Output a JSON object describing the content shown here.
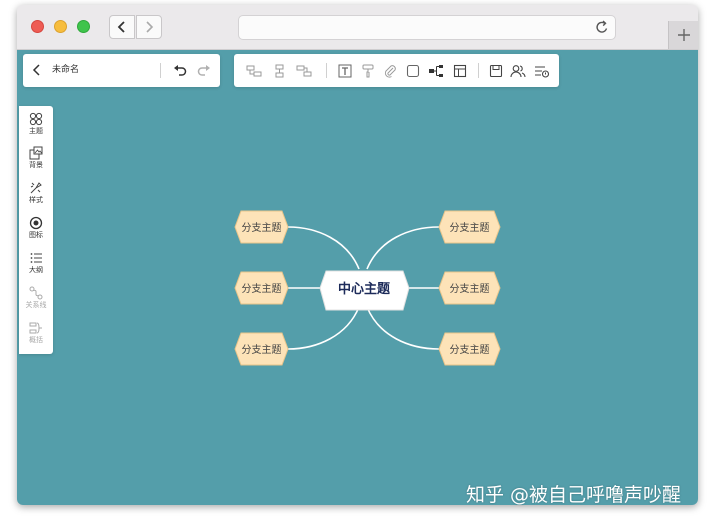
{
  "browser": {
    "url": "",
    "icons": {
      "back": "chevron-left-icon",
      "forward": "chevron-right-icon",
      "reload": "reload-icon",
      "new_tab": "plus-icon"
    }
  },
  "editor": {
    "document_title": "未命名",
    "toolbar_icons": [
      "insert-sibling-icon",
      "insert-child-icon",
      "insert-parent-icon",
      "text-icon",
      "format-painter-icon",
      "attachment-icon",
      "frame-icon",
      "structure-icon",
      "layout-icon",
      "save-icon",
      "collaborators-icon",
      "outline-view-icon"
    ],
    "sidebar": [
      {
        "label": "主题",
        "icon": "theme-icon",
        "disabled": false
      },
      {
        "label": "背景",
        "icon": "background-icon",
        "disabled": false
      },
      {
        "label": "样式",
        "icon": "style-icon",
        "disabled": false
      },
      {
        "label": "图标",
        "icon": "target-icon",
        "disabled": false
      },
      {
        "label": "大纲",
        "icon": "list-icon",
        "disabled": false
      },
      {
        "label": "关系线",
        "icon": "relation-line-icon",
        "disabled": true
      },
      {
        "label": "概括",
        "icon": "summary-icon",
        "disabled": true
      }
    ]
  },
  "mindmap": {
    "center": "中心主题",
    "branches": [
      "分支主题",
      "分支主题",
      "分支主题",
      "分支主题",
      "分支主题",
      "分支主题"
    ]
  },
  "colors": {
    "canvas": "#549eaa",
    "branch_fill": "#fde3b8",
    "branch_stroke": "#e8c48a",
    "center_fill": "#ffffff",
    "center_text": "#1d2b5a"
  },
  "watermark": "知乎 @被自己呼噜声吵醒"
}
